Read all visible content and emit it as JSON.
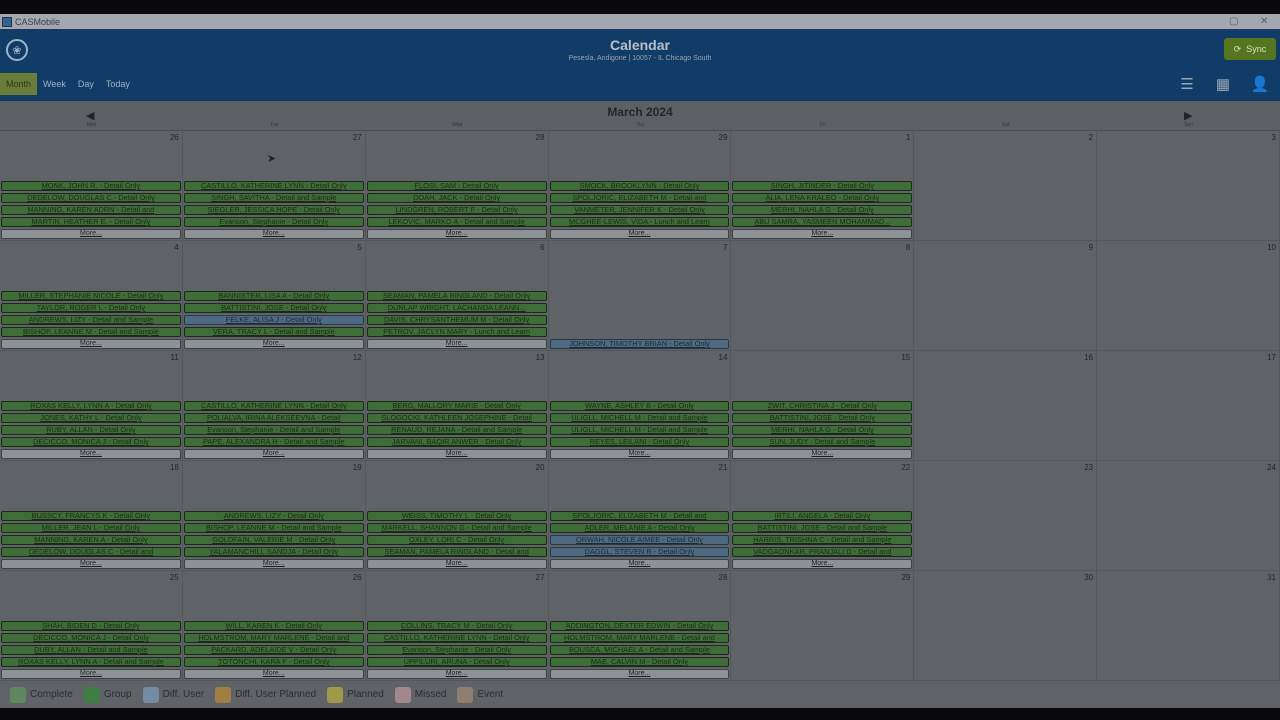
{
  "window": {
    "title": "CASMobile",
    "controls": [
      "▢",
      "✕"
    ]
  },
  "header": {
    "title": "Calendar",
    "subtitle": "Pesesla, Andigone | 10057 - IL Chicago South",
    "logo_icon": "❀",
    "sync_label": "Sync",
    "sync_icon": "⟳",
    "views": [
      "Month",
      "Week",
      "Day",
      "Today"
    ],
    "active_view": "Month",
    "icons": {
      "list": "☰",
      "map": "▦",
      "user": "👤"
    }
  },
  "month_nav": {
    "title": "March 2024",
    "prev": "◀",
    "next": "▶"
  },
  "weekdays": [
    "Mon",
    "Tue",
    "Wed",
    "Thu",
    "Fri",
    "Sat",
    "Sun"
  ],
  "colors": {
    "complete": "#5fb85a",
    "group": "#18a51c",
    "diff_user": "#8ec2ea",
    "diff_user_planned": "#f0a11b",
    "planned": "#f1dd27",
    "missed": "#f3b6c0",
    "event": "#c9a27c"
  },
  "weeks": [
    {
      "days": [
        {
          "num": "26",
          "events": [
            {
              "t": "MONK, JOHN R. - Detail Only",
              "k": "c"
            },
            {
              "t": "DEDELOW, DOUGLAS C - Detail Only",
              "k": "c"
            },
            {
              "t": "MANNING, KAREN ADRN - Detail and",
              "k": "c"
            },
            {
              "t": "MARTIN, HEATHER E. - Detail Only",
              "k": "c"
            }
          ],
          "more": "More..."
        },
        {
          "num": "27",
          "events": [
            {
              "t": "CASTILLO, KATHERINE LYNN - Detail Only",
              "k": "c"
            },
            {
              "t": "SINGH, SAVITHA - Detail and Sample",
              "k": "c"
            },
            {
              "t": "SIEGLER, JESSICA HOPE - Detail Only",
              "k": "c"
            },
            {
              "t": "Evanson, Stephanie - Detail Only",
              "k": "c"
            }
          ],
          "more": "More..."
        },
        {
          "num": "28",
          "events": [
            {
              "t": "FLOSI, SAM - Detail Only",
              "k": "c"
            },
            {
              "t": "DOAH, JACK - Detail Only",
              "k": "c"
            },
            {
              "t": "LINDGREN, ROBERT F - Detail Only",
              "k": "c"
            },
            {
              "t": "LEKOVIC, MARKO A - Detail and Sample",
              "k": "c"
            }
          ],
          "more": "More..."
        },
        {
          "num": "29",
          "events": [
            {
              "t": "SMOCK, BROOKLYNN - Detail Only",
              "k": "c"
            },
            {
              "t": "SPOLJORIC, ELIZABETH M - Detail and",
              "k": "c"
            },
            {
              "t": "VANMETER, JENNIFER K - Detail Only",
              "k": "c"
            },
            {
              "t": "MCGHEE-LEWIS, VIDA - Lunch and Learn",
              "k": "c"
            }
          ],
          "more": "More..."
        },
        {
          "num": "1",
          "events": [
            {
              "t": "SINGH, JITINDER - Detail Only",
              "k": "c"
            },
            {
              "t": "ALIA, LENA KRALEO - Detail Only",
              "k": "c"
            },
            {
              "t": "MERHI, NAHLA G - Detail Only",
              "k": "c"
            },
            {
              "t": "ABU SAMRA, YASMEEN MOHAMMAD...",
              "k": "c"
            }
          ],
          "more": "More..."
        },
        {
          "num": "2",
          "events": [],
          "more": ""
        },
        {
          "num": "3",
          "events": [],
          "more": ""
        }
      ]
    },
    {
      "days": [
        {
          "num": "4",
          "events": [
            {
              "t": "MILLER, STEPHANIE NICOLE - Detail Only",
              "k": "c"
            },
            {
              "t": "TAYLOR, ROGER L - Detail Only",
              "k": "c"
            },
            {
              "t": "ANDREWS, LIZY - Detail and Sample",
              "k": "c"
            },
            {
              "t": "BISHOP, LEANNE M - Detail and Sample",
              "k": "c"
            }
          ],
          "more": "More..."
        },
        {
          "num": "5",
          "events": [
            {
              "t": "BANNISTER, LISA A - Detail Only",
              "k": "c"
            },
            {
              "t": "BATTISTINI, JOSE - Detail Only",
              "k": "c"
            },
            {
              "t": "FELKE, ALISA J - Detail Only",
              "k": "d"
            },
            {
              "t": "VERA, TRACY L - Detail and Sample",
              "k": "c"
            }
          ],
          "more": "More..."
        },
        {
          "num": "6",
          "events": [
            {
              "t": "SEAMAN, PAMELA RINGLAND - Detail Only",
              "k": "c"
            },
            {
              "t": "DUNLAP WRIGHT, LACHANDA LEANN...",
              "k": "c"
            },
            {
              "t": "DAVIS, CHRYSANTHEMUM M - Detail Only",
              "k": "c"
            },
            {
              "t": "PETROV, JACLYN MARY - Lunch and Learn",
              "k": "c"
            }
          ],
          "more": "More..."
        },
        {
          "num": "7",
          "events": [
            {
              "t": "",
              "k": ""
            },
            {
              "t": "",
              "k": ""
            },
            {
              "t": "",
              "k": ""
            },
            {
              "t": "",
              "k": ""
            },
            {
              "t": "JOHNSON, TIMOTHY BRIAN - Detail Only",
              "k": "d"
            }
          ],
          "more": ""
        },
        {
          "num": "8",
          "events": [],
          "more": ""
        },
        {
          "num": "9",
          "events": [],
          "more": ""
        },
        {
          "num": "10",
          "events": [],
          "more": ""
        }
      ]
    },
    {
      "days": [
        {
          "num": "11",
          "events": [
            {
              "t": "ROXAS KELLY, LYNN A - Detail Only",
              "k": "c"
            },
            {
              "t": "JONES, KATHY L - Detail Only",
              "k": "c"
            },
            {
              "t": "RUBY, ALLAN - Detail Only",
              "k": "c"
            },
            {
              "t": "DECICCO, MONICA J - Detail Only",
              "k": "c"
            }
          ],
          "more": "More..."
        },
        {
          "num": "12",
          "events": [
            {
              "t": "CASTILLO, KATHERINE LYNN - Detail Only",
              "k": "c"
            },
            {
              "t": "POLIALVA, IRINA ALEKSEEVNA - Detail",
              "k": "c"
            },
            {
              "t": "Evanson, Stephanie - Detail and Sample",
              "k": "c"
            },
            {
              "t": "PAPE, ALEXANDRA H - Detail and Sample",
              "k": "c"
            }
          ],
          "more": "More..."
        },
        {
          "num": "13",
          "events": [
            {
              "t": "BERG, MALLORY MARIE - Detail Only",
              "k": "c"
            },
            {
              "t": "SLOGOCKI, KATHLEEN JOSEPHINE - Detail",
              "k": "c"
            },
            {
              "t": "RENAUD, REJANA - Detail and Sample",
              "k": "c"
            },
            {
              "t": "JARVANI, BAQIR ANWER - Detail Only",
              "k": "c"
            }
          ],
          "more": "More..."
        },
        {
          "num": "14",
          "events": [
            {
              "t": "WAYNE, ASHLEY B - Detail Only",
              "k": "c"
            },
            {
              "t": "ULIGLL, MICHELL M - Detail and Sample",
              "k": "c"
            },
            {
              "t": "ULIGLL, MICHELL M - Detail and Sample",
              "k": "c"
            },
            {
              "t": "REYES, LEILANI - Detail Only",
              "k": "c"
            }
          ],
          "more": "More..."
        },
        {
          "num": "15",
          "events": [
            {
              "t": "ZWIT, CHRISTINA J - Detail Only",
              "k": "c"
            },
            {
              "t": "BATTISTINI, JOSE - Detail Only",
              "k": "c"
            },
            {
              "t": "MERHI, NAHLA G - Detail Only",
              "k": "c"
            },
            {
              "t": "SUN, JUDY - Detail and Sample",
              "k": "c"
            }
          ],
          "more": "More..."
        },
        {
          "num": "16",
          "events": [],
          "more": ""
        },
        {
          "num": "17",
          "events": [],
          "more": ""
        }
      ]
    },
    {
      "days": [
        {
          "num": "18",
          "events": [
            {
              "t": "BUSSCY, FRANCYS K - Detail Only",
              "k": "c"
            },
            {
              "t": "MILLER, JEAN L - Detail Only",
              "k": "c"
            },
            {
              "t": "MANNING, KAREN A - Detail Only",
              "k": "c"
            },
            {
              "t": "DEDELOW, DOUGLAS C - Detail and",
              "k": "c"
            }
          ],
          "more": "More..."
        },
        {
          "num": "19",
          "events": [
            {
              "t": "ANDREWS, LIZY - Detail Only",
              "k": "c"
            },
            {
              "t": "BISHOP, LEANNE M - Detail and Sample",
              "k": "c"
            },
            {
              "t": "GOLDFAIN, VALERIE M - Detail Only",
              "k": "c"
            },
            {
              "t": "YALAMANCHILI, SANDJA - Detail Only",
              "k": "c"
            }
          ],
          "more": "More..."
        },
        {
          "num": "20",
          "events": [
            {
              "t": "WEISS, TIMOTHY L - Detail Only",
              "k": "c"
            },
            {
              "t": "MARKELL, SHANNON G - Detail and Sample",
              "k": "c"
            },
            {
              "t": "OXLEY, LORI C - Detail Only",
              "k": "c"
            },
            {
              "t": "SEAMAN, PAMELA RINGLAND - Detail and",
              "k": "c"
            }
          ],
          "more": "More..."
        },
        {
          "num": "21",
          "events": [
            {
              "t": "SPOLJORIC, ELIZABETH M - Detail and",
              "k": "c"
            },
            {
              "t": "ADLER, MELANIE A - Detail Only",
              "k": "c"
            },
            {
              "t": "ORWAH, NICOLE AIMEE - Detail Only",
              "k": "d"
            },
            {
              "t": "DAGGL, STEVEN R - Detail Only",
              "k": "d"
            }
          ],
          "more": "More..."
        },
        {
          "num": "22",
          "events": [
            {
              "t": "IRTILI, ANGELA - Detail Only",
              "k": "c"
            },
            {
              "t": "BATTISTINI, JOSE - Detail and Sample",
              "k": "c"
            },
            {
              "t": "HARRIS, TRISHNA C - Detail and Sample",
              "k": "c"
            },
            {
              "t": "VADGAONKAR, PRANJALI D - Detail and",
              "k": "c"
            }
          ],
          "more": "More..."
        },
        {
          "num": "23",
          "events": [],
          "more": ""
        },
        {
          "num": "24",
          "events": [],
          "more": ""
        }
      ]
    },
    {
      "days": [
        {
          "num": "25",
          "events": [
            {
              "t": "SHAH, BIDEN D - Detail Only",
              "k": "c"
            },
            {
              "t": "DECICCO, MONICA J - Detail Only",
              "k": "c"
            },
            {
              "t": "DUBY, ALLAN - Detail and Sample",
              "k": "c"
            },
            {
              "t": "ROXAS KELLY, LYNN A - Detail and Sample",
              "k": "c"
            }
          ],
          "more": "More..."
        },
        {
          "num": "26",
          "events": [
            {
              "t": "WILL, KAREN K - Detail Only",
              "k": "c"
            },
            {
              "t": "HOLMSTROM, MARY MARLENE - Detail and",
              "k": "c"
            },
            {
              "t": "PACKARD, ADELAIDE V - Detail Only",
              "k": "c"
            },
            {
              "t": "TOTONCHI, KARA F - Detail Only",
              "k": "c"
            }
          ],
          "more": "More..."
        },
        {
          "num": "27",
          "events": [
            {
              "t": "COLLINS, TRACY M - Detail Only",
              "k": "c"
            },
            {
              "t": "CASTILLO, KATHERINE LYNN - Detail Only",
              "k": "c"
            },
            {
              "t": "Evanson, Stephanie - Detail Only",
              "k": "c"
            },
            {
              "t": "UPPILURI, ARUNA - Detail Only",
              "k": "c"
            }
          ],
          "more": "More..."
        },
        {
          "num": "28",
          "events": [
            {
              "t": "ADDINGTON, DEXTER EDWIN - Detail Only",
              "k": "c"
            },
            {
              "t": "HOLMSTROM, MARY MARLENE - Detail and",
              "k": "c"
            },
            {
              "t": "BOUSCA, MICHAEL A - Detail and Sample",
              "k": "c"
            },
            {
              "t": "MAE, CALVIN M - Detail Only",
              "k": "c"
            }
          ],
          "more": "More..."
        },
        {
          "num": "29",
          "events": [],
          "more": ""
        },
        {
          "num": "30",
          "events": [],
          "more": ""
        },
        {
          "num": "31",
          "events": [],
          "more": ""
        }
      ]
    }
  ],
  "legend": [
    {
      "label": "Complete",
      "color": "#5fb85a"
    },
    {
      "label": "Group",
      "color": "#18a51c"
    },
    {
      "label": "Diff. User",
      "color": "#8ec2ea"
    },
    {
      "label": "Diff. User Planned",
      "color": "#f0a11b"
    },
    {
      "label": "Planned",
      "color": "#f1dd27"
    },
    {
      "label": "Missed",
      "color": "#f3b6c0"
    },
    {
      "label": "Event",
      "color": "#c9a27c"
    }
  ]
}
